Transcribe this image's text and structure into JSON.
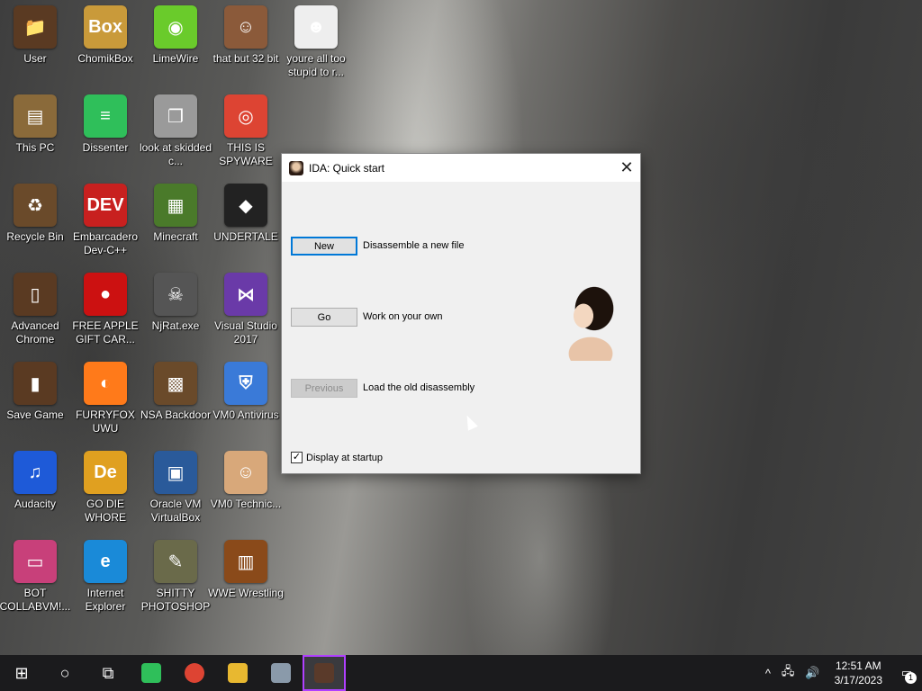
{
  "desktop": {
    "icons": [
      {
        "label": "User",
        "glyph": "📁",
        "color": "#5a3a22"
      },
      {
        "label": "ChomikBox",
        "glyph": "Box",
        "color": "#c99a3a"
      },
      {
        "label": "LimeWire",
        "glyph": "◉",
        "color": "#6acb2b"
      },
      {
        "label": "that but 32 bit",
        "glyph": "☺",
        "color": "#8b5a3a"
      },
      {
        "label": "youre all too stupid to r...",
        "glyph": "☻",
        "color": "#eeeeee"
      },
      {
        "label": "This PC",
        "glyph": "▤",
        "color": "#8a6a3a"
      },
      {
        "label": "Dissenter",
        "glyph": "≡",
        "color": "#2fbf5a"
      },
      {
        "label": "look at skidded c...",
        "glyph": "❐",
        "color": "#9a9a9a"
      },
      {
        "label": "THIS IS SPYWARE",
        "glyph": "◎",
        "color": "#dd4433"
      },
      {
        "label": "Recycle Bin",
        "glyph": "♻",
        "color": "#6a4a2a"
      },
      {
        "label": "Embarcadero Dev-C++",
        "glyph": "DEV",
        "color": "#c8201f"
      },
      {
        "label": "Minecraft",
        "glyph": "▦",
        "color": "#4a7a2a"
      },
      {
        "label": "UNDERTALE",
        "glyph": "◆",
        "color": "#222222"
      },
      {
        "label": "Advanced Chrome",
        "glyph": "▯",
        "color": "#5a3a22"
      },
      {
        "label": "FREE APPLE GIFT CAR...",
        "glyph": "●",
        "color": "#cc1111"
      },
      {
        "label": "NjRat.exe",
        "glyph": "☠",
        "color": "#555555"
      },
      {
        "label": "Visual Studio 2017",
        "glyph": "⋈",
        "color": "#6a3aa8"
      },
      {
        "label": "Save Game",
        "glyph": "▮",
        "color": "#5a3a22"
      },
      {
        "label": "FURRYFOX UWU",
        "glyph": "◐",
        "color": "#ff7a1a"
      },
      {
        "label": "NSA Backdoor",
        "glyph": "▩",
        "color": "#6a4a2a"
      },
      {
        "label": "VM0 Antivirus",
        "glyph": "⛨",
        "color": "#3a7ad8"
      },
      {
        "label": "Audacity",
        "glyph": "♫",
        "color": "#1e5ad8"
      },
      {
        "label": "GO DIE WHORE",
        "glyph": "De",
        "color": "#e0a020"
      },
      {
        "label": "Oracle VM VirtualBox",
        "glyph": "▣",
        "color": "#2a5a9a"
      },
      {
        "label": "VM0 Technic...",
        "glyph": "☺",
        "color": "#d8a87a"
      },
      {
        "label": "BOT COLLABVM!...",
        "glyph": "▭",
        "color": "#c8407a"
      },
      {
        "label": "Internet Explorer",
        "glyph": "e",
        "color": "#1a8ad8"
      },
      {
        "label": "SHITTY PHOTOSHOP",
        "glyph": "✎",
        "color": "#6a6a4a"
      },
      {
        "label": "WWE Wrestling",
        "glyph": "▥",
        "color": "#8a4a1a"
      }
    ]
  },
  "dialog": {
    "title": "IDA: Quick start",
    "close": "✕",
    "buttons": [
      {
        "label": "New",
        "desc": "Disassemble a new file"
      },
      {
        "label": "Go",
        "desc": "Work on your own"
      },
      {
        "label": "Previous",
        "desc": "Load the old disassembly"
      }
    ],
    "checkbox": {
      "label": "Display at startup",
      "checked": "✓"
    }
  },
  "taskbar": {
    "start": "⊞",
    "search": "○",
    "taskview": "⧉",
    "apps": [
      {
        "name": "dissenter",
        "color": "#2fbf5a"
      },
      {
        "name": "chrome",
        "color": "#dd4433"
      },
      {
        "name": "file-explorer",
        "color": "#e8b830"
      },
      {
        "name": "network-app",
        "color": "#8a9aaa"
      },
      {
        "name": "ida",
        "color": "#5a3a2a"
      }
    ],
    "tray": {
      "chevron": "^",
      "network": "🖧",
      "volume": "🔊",
      "time": "12:51 AM",
      "date": "3/17/2023",
      "notification_count": "1"
    }
  }
}
